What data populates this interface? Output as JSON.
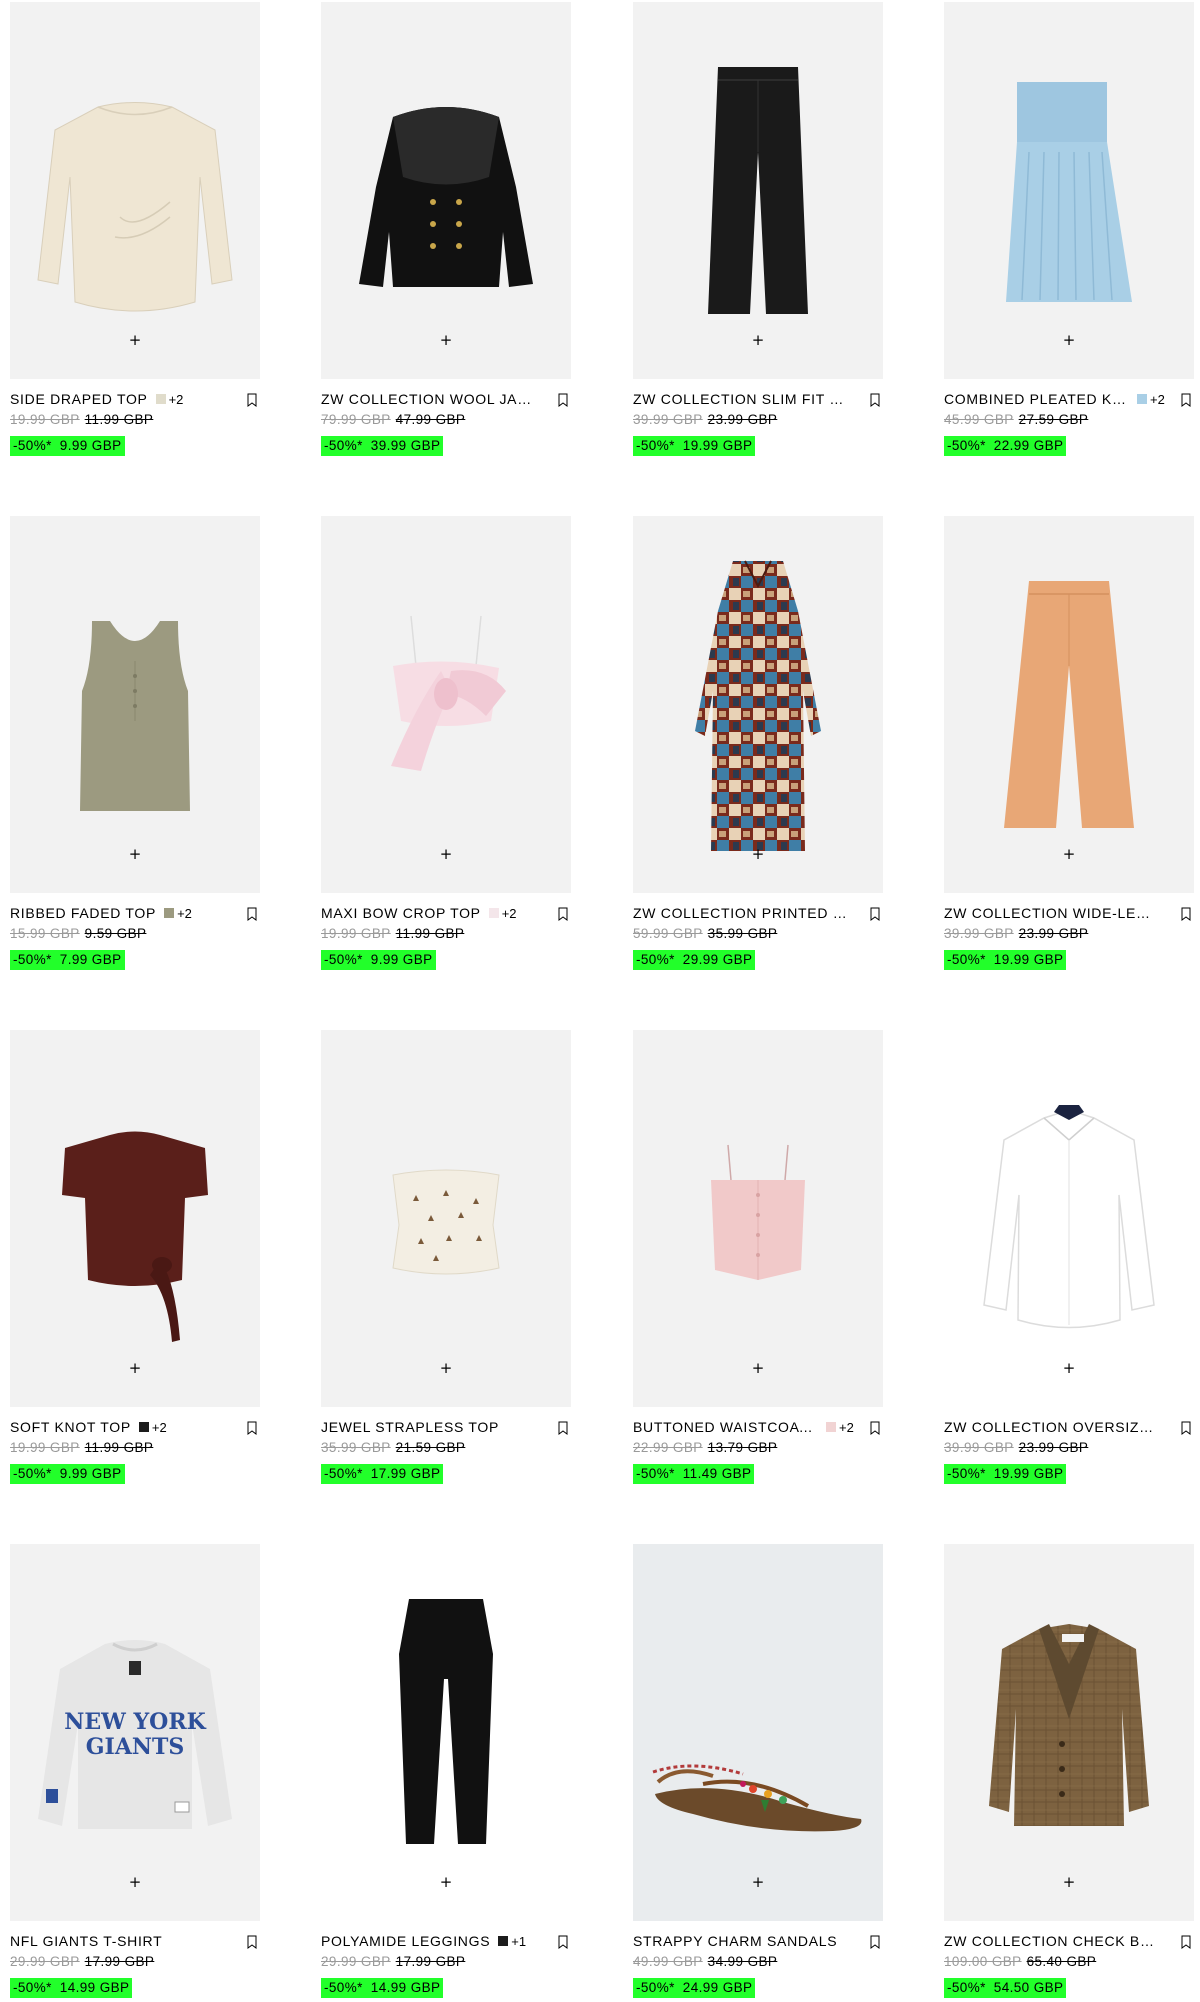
{
  "products": [
    {
      "name": "SIDE DRAPED TOP",
      "swatch": "#e0dccb",
      "more": "+2",
      "orig": "19.99 GBP",
      "mid": "11.99 GBP",
      "pct": "-50%*",
      "price": "9.99 GBP",
      "icon": "draped-top-image"
    },
    {
      "name": "ZW COLLECTION WOOL JACKET",
      "swatch": null,
      "more": null,
      "orig": "79.99 GBP",
      "mid": "47.99 GBP",
      "pct": "-50%*",
      "price": "39.99 GBP",
      "icon": "wool-jacket-image"
    },
    {
      "name": "ZW COLLECTION SLIM FIT HIGH-WAIST JEANS",
      "swatch": null,
      "more": null,
      "orig": "39.99 GBP",
      "mid": "23.99 GBP",
      "pct": "-50%*",
      "price": "19.99 GBP",
      "icon": "black-jeans-image"
    },
    {
      "name": "COMBINED PLEATED KILT SKIRT",
      "swatch": "#a9cfe6",
      "more": "+2",
      "orig": "45.99 GBP",
      "mid": "27.59 GBP",
      "pct": "-50%*",
      "price": "22.99 GBP",
      "icon": "pleated-skirt-image"
    },
    {
      "name": "RIBBED FADED TOP",
      "swatch": "#9c9a80",
      "more": "+2",
      "orig": "15.99 GBP",
      "mid": "9.59 GBP",
      "pct": "-50%*",
      "price": "7.99 GBP",
      "icon": "tank-top-image"
    },
    {
      "name": "MAXI BOW CROP TOP",
      "swatch": "#f4e6ea",
      "more": "+2",
      "orig": "19.99 GBP",
      "mid": "11.99 GBP",
      "pct": "-50%*",
      "price": "9.99 GBP",
      "icon": "bow-top-image"
    },
    {
      "name": "ZW COLLECTION PRINTED LONG DRESS",
      "swatch": null,
      "more": null,
      "orig": "59.99 GBP",
      "mid": "35.99 GBP",
      "pct": "-50%*",
      "price": "29.99 GBP",
      "icon": "printed-dress-image"
    },
    {
      "name": "ZW COLLECTION WIDE-LEG JEANS",
      "swatch": null,
      "more": null,
      "orig": "39.99 GBP",
      "mid": "23.99 GBP",
      "pct": "-50%*",
      "price": "19.99 GBP",
      "icon": "wide-leg-jeans-image"
    },
    {
      "name": "SOFT KNOT TOP",
      "swatch": "#1c1c1c",
      "more": "+2",
      "orig": "19.99 GBP",
      "mid": "11.99 GBP",
      "pct": "-50%*",
      "price": "9.99 GBP",
      "icon": "knot-top-image"
    },
    {
      "name": "JEWEL STRAPLESS TOP",
      "swatch": null,
      "more": null,
      "orig": "35.99 GBP",
      "mid": "21.59 GBP",
      "pct": "-50%*",
      "price": "17.99 GBP",
      "icon": "strapless-top-image"
    },
    {
      "name": "BUTTONED WAISTCOAT TOP",
      "swatch": "#f1d3d3",
      "more": "+2",
      "orig": "22.99 GBP",
      "mid": "13.79 GBP",
      "pct": "-50%*",
      "price": "11.49 GBP",
      "icon": "waistcoat-top-image"
    },
    {
      "name": "ZW COLLECTION OVERSIZE POPLIN SHIRT",
      "swatch": null,
      "more": null,
      "orig": "39.99 GBP",
      "mid": "23.99 GBP",
      "pct": "-50%*",
      "price": "19.99 GBP",
      "icon": "white-shirt-image"
    },
    {
      "name": "NFL GIANTS T-SHIRT",
      "swatch": null,
      "more": null,
      "orig": "29.99 GBP",
      "mid": "17.99 GBP",
      "pct": "-50%*",
      "price": "14.99 GBP",
      "icon": "giants-tshirt-image",
      "graphic": {
        "line1": "NEW YORK",
        "line2": "GIANTS"
      }
    },
    {
      "name": "POLYAMIDE LEGGINGS",
      "swatch": "#1c1c1c",
      "more": "+1",
      "orig": "29.99 GBP",
      "mid": "17.99 GBP",
      "pct": "-50%*",
      "price": "14.99 GBP",
      "icon": "leggings-image"
    },
    {
      "name": "STRAPPY CHARM SANDALS",
      "swatch": null,
      "more": null,
      "orig": "49.99 GBP",
      "mid": "34.99 GBP",
      "pct": "-50%*",
      "price": "24.99 GBP",
      "icon": "sandals-image"
    },
    {
      "name": "ZW COLLECTION CHECK BLAZER",
      "swatch": null,
      "more": null,
      "orig": "109.00 GBP",
      "mid": "65.40 GBP",
      "pct": "-50%*",
      "price": "54.50 GBP",
      "icon": "check-blazer-image"
    }
  ],
  "quick_add_symbol": "+",
  "colors": {
    "sale_highlight": "#22ff2a",
    "strike_grey": "#9a9a9a",
    "card_bg": "#f2f2f2"
  }
}
